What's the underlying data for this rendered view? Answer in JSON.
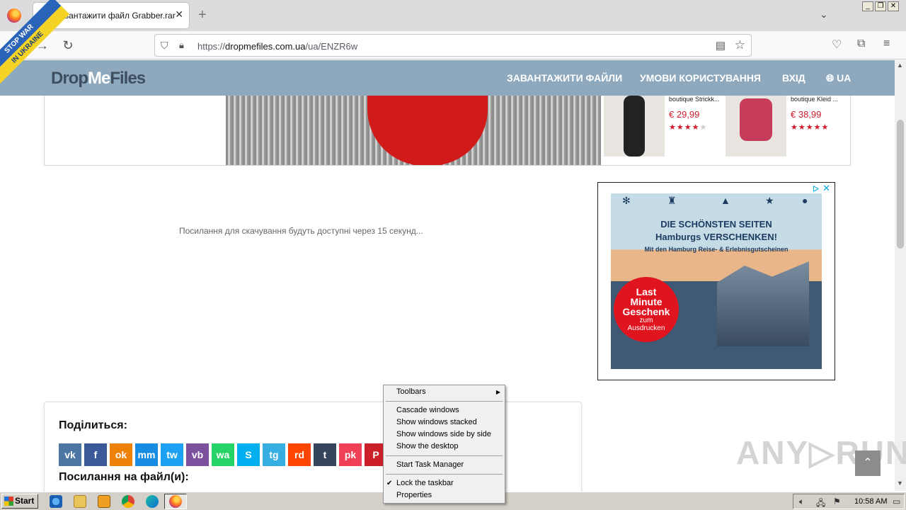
{
  "browser": {
    "tab_title": "Завантажити файл Grabber.rar",
    "tab_close": "✕",
    "new_tab": "+",
    "tab_list": "⌄",
    "url_prefix": "https://",
    "url_host": "dropmefiles.com.ua",
    "url_path": "/ua/ENZR6w",
    "window_minimize": "_",
    "window_restore": "❐",
    "window_close": "✕"
  },
  "site": {
    "logo_part1": "Drop",
    "logo_part2": "Me",
    "logo_part3": "Files",
    "nav": [
      "ЗАВАНТАЖИТИ ФАЙЛИ",
      "УМОВИ КОРИСТУВАННЯ",
      "ВХІД",
      "UA"
    ],
    "ribbon_line1": "STOP WAR",
    "ribbon_line2": "IN UKRAINE"
  },
  "top_ad": {
    "products": [
      {
        "name": "boutique Strickk...",
        "price": "€ 29,99",
        "stars": "★★★★",
        "stars_off": "★"
      },
      {
        "name": "boutique Kleid ...",
        "price": "€ 38,99",
        "stars": "★★★★★",
        "stars_off": ""
      }
    ]
  },
  "main": {
    "wait_text": "Посилання для скачування будуть доступні через 15 секунд..."
  },
  "side_ad": {
    "choice": "ᐅ",
    "close": "✕",
    "headline1": "DIE SCHÖNSTEN SEITEN",
    "headline2": "Hamburgs VERSCHENKEN!",
    "subline": "Mit den Hamburg Reise- & Erlebnisgutscheinen",
    "badge_line1": "Last",
    "badge_line2": "Minute",
    "badge_line3": "Geschenk",
    "badge_line4": "zum",
    "badge_line5": "Ausdrucken"
  },
  "share": {
    "title": "Поділиться:",
    "links_title": "Посилання на файл(и):",
    "buttons": [
      {
        "label": "vk",
        "color": "#4c75a3"
      },
      {
        "label": "f",
        "color": "#3b5998"
      },
      {
        "label": "ok",
        "color": "#ee8208"
      },
      {
        "label": "mm",
        "color": "#168de2"
      },
      {
        "label": "tw",
        "color": "#1da1f2"
      },
      {
        "label": "vb",
        "color": "#7b519d"
      },
      {
        "label": "wa",
        "color": "#25d366"
      },
      {
        "label": "S",
        "color": "#00aff0"
      },
      {
        "label": "tg",
        "color": "#37aee2"
      },
      {
        "label": "rd",
        "color": "#ff4500"
      },
      {
        "label": "t",
        "color": "#35465c"
      },
      {
        "label": "pk",
        "color": "#ef4056"
      },
      {
        "label": "P",
        "color": "#cb2027"
      }
    ]
  },
  "watermark": "ANY▷RUN",
  "context_menu": {
    "toolbars": "Toolbars",
    "cascade": "Cascade windows",
    "stacked": "Show windows stacked",
    "side_by_side": "Show windows side by side",
    "desktop": "Show the desktop",
    "task_manager": "Start Task Manager",
    "lock": "Lock the taskbar",
    "properties": "Properties"
  },
  "taskbar": {
    "start": "Start",
    "clock": "10:58 AM"
  }
}
